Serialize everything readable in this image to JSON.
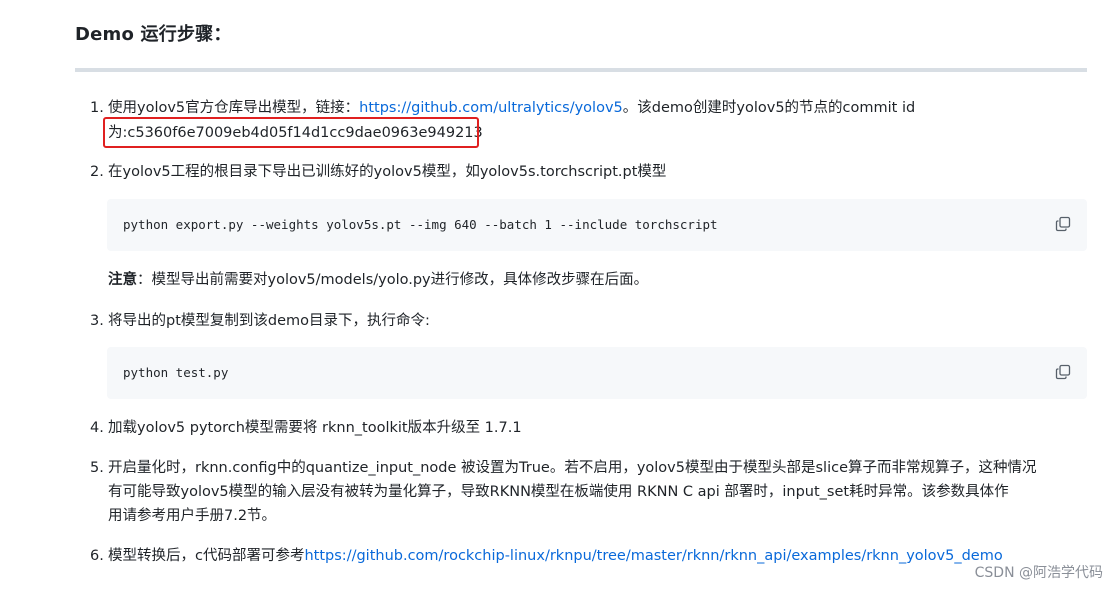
{
  "heading": "Demo 运行步骤：",
  "steps": {
    "s1": {
      "number": "1.",
      "text_before": "使用yolov5官方仓库导出模型，链接：",
      "link": "https://github.com/ultralytics/yolov5",
      "text_after": "。该demo创建时yolov5的节点的commit id",
      "line2": "为:c5360f6e7009eb4d05f14d1cc9dae0963e949213"
    },
    "s2": {
      "number": "2.",
      "text": "在yolov5工程的根目录下导出已训练好的yolov5模型，如yolov5s.torchscript.pt模型",
      "code": "python export.py --weights yolov5s.pt --img 640 --batch 1 --include torchscript",
      "note_label": "注意",
      "note_text": "：模型导出前需要对yolov5/models/yolo.py进行修改，具体修改步骤在后面。"
    },
    "s3": {
      "number": "3.",
      "text": "将导出的pt模型复制到该demo目录下，执行命令:",
      "code": "python test.py"
    },
    "s4": {
      "number": "4.",
      "text": "加载yolov5 pytorch模型需要将 rknn_toolkit版本升级至 1.7.1"
    },
    "s5": {
      "number": "5.",
      "line1": "开启量化时，rknn.config中的quantize_input_node 被设置为True。若不启用，yolov5模型由于模型头部是slice算子而非常规算子，这种情况",
      "line2": "有可能导致yolov5模型的输入层没有被转为量化算子，导致RKNN模型在板端使用 RKNN C api 部署时，input_set耗时异常。该参数具体作",
      "line3": "用请参考用户手册7.2节。"
    },
    "s6": {
      "number": "6.",
      "text": "模型转换后，c代码部署可参考",
      "link": "https://github.com/rockchip-linux/rknpu/tree/master/rknn/rknn_api/examples/rknn_yolov5_demo"
    }
  },
  "watermark": "CSDN @阿浩学代码",
  "colors": {
    "link": "#0969da",
    "highlight_border": "#e02020",
    "code_background": "#f6f8fa"
  },
  "icons": {
    "copy": "copy-icon"
  }
}
